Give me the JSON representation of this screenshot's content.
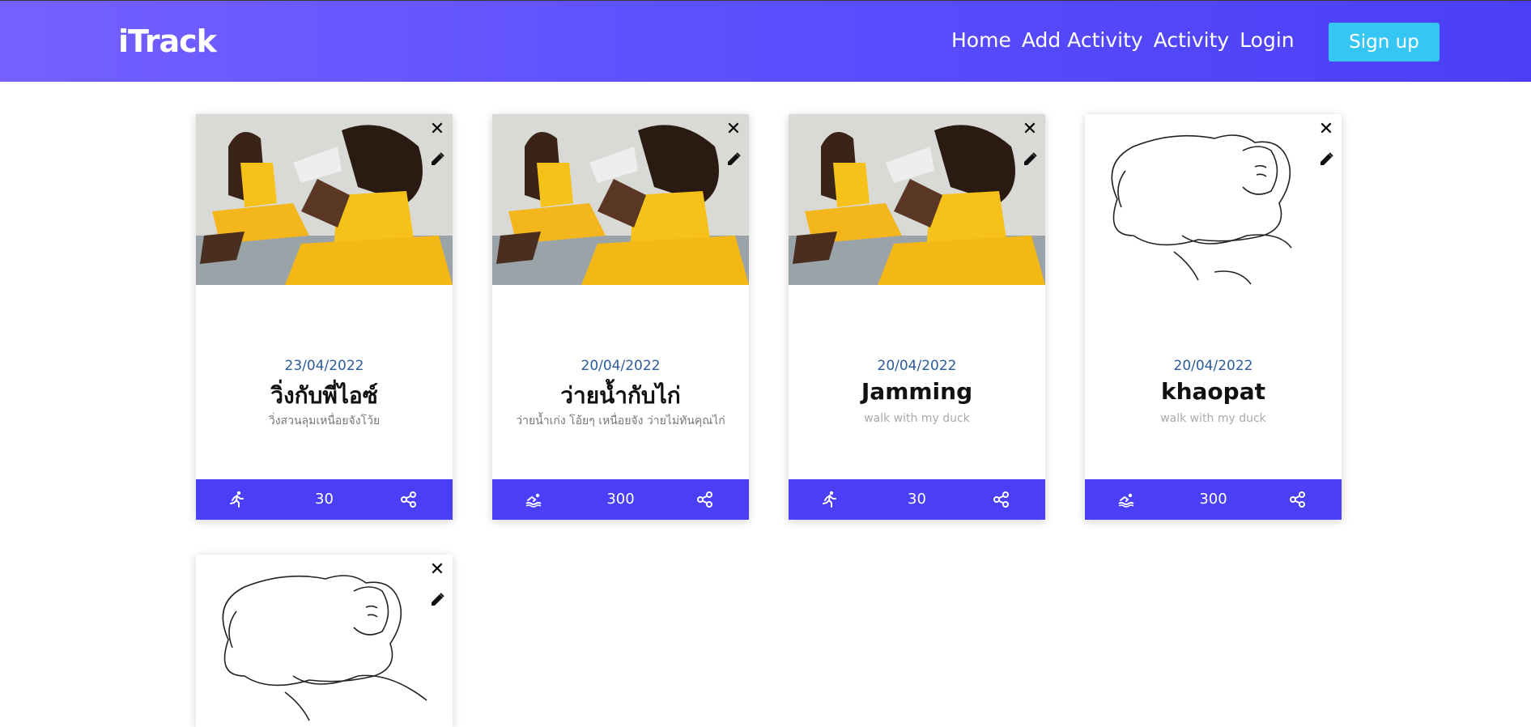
{
  "app": {
    "brand": "iTrack"
  },
  "nav": {
    "links": [
      "Home",
      "Add Activity",
      "Activity",
      "Login"
    ],
    "signup": "Sign up"
  },
  "cards": [
    {
      "date": "23/04/2022",
      "title": "วิ่งกับพี่ไอซ์",
      "description": "วิ่งสวนลุมเหนื่อยจังโว้ย",
      "activity_icon": "running-icon",
      "value": "30",
      "image": "athletes-photo"
    },
    {
      "date": "20/04/2022",
      "title": "ว่ายน้ำกับไก่",
      "description": "ว่ายน้ำเก่ง โอ้ยๆ เหนื่อยจัง ว่ายไม่ทันคุณไก่",
      "activity_icon": "swimming-icon",
      "value": "300",
      "image": "athletes-photo"
    },
    {
      "date": "20/04/2022",
      "title": "Jamming",
      "description": "walk with my duck",
      "activity_icon": "running-icon",
      "value": "30",
      "image": "athletes-photo"
    },
    {
      "date": "20/04/2022",
      "title": "khaopat",
      "description": "walk with my duck",
      "activity_icon": "swimming-icon",
      "value": "300",
      "image": "sketch-drawing"
    }
  ],
  "colors": {
    "navbar": "#5c50ff",
    "accent": "#4a3ff7",
    "signup": "#36c6f4",
    "date": "#2c5b9a"
  }
}
